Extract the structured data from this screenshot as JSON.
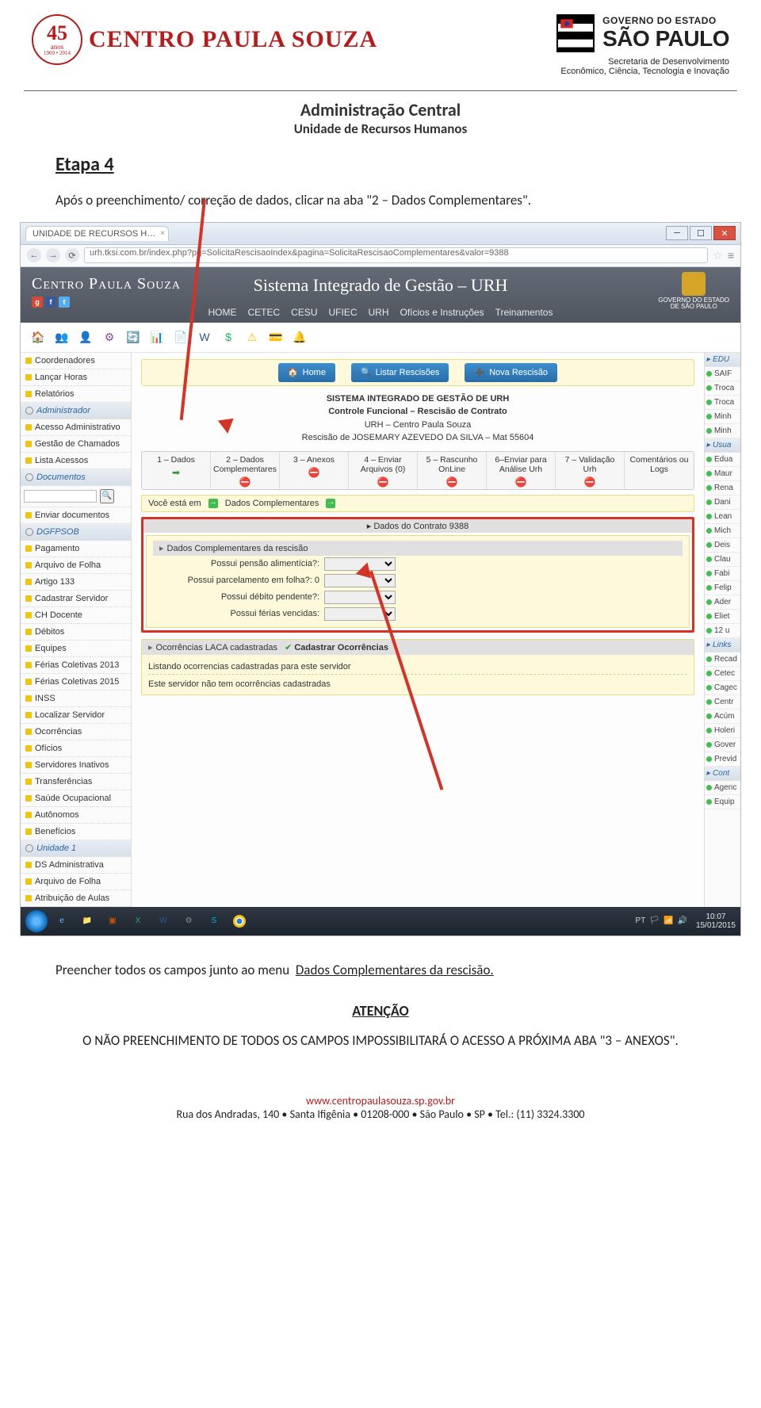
{
  "header": {
    "badge": {
      "years": "45",
      "sub_top": "anos",
      "sub_bottom": "1969 • 2014"
    },
    "cps": "CENTRO PAULA SOUZA",
    "sp": {
      "gov": "GOVERNO DO ESTADO",
      "state": "SÃO PAULO",
      "secretaria": "Secretaria de Desenvolvimento\nEconômico, Ciência, Tecnologia e Inovação"
    }
  },
  "titles": {
    "t1": "Administração Central",
    "t2": "Unidade de Recursos Humanos"
  },
  "etapa": "Etapa 4",
  "para_top": "Após o preenchimento/ correção de dados, clicar na aba \"2 – Dados Complementares\".",
  "para_below_shot": "Preencher todos os campos junto ao menu  Dados Complementares da rescisão.",
  "atencao": "ATENÇÃO",
  "para_warn": "O NÃO PREENCHIMENTO DE TODOS OS CAMPOS IMPOSSIBILITARÁ O ACESSO A PRÓXIMA ABA \"3 – ANEXOS\".",
  "footer": {
    "url": "www.centropaulasouza.sp.gov.br",
    "addr": "Rua dos Andradas, 140 • Santa Ifigênia • 01208-000 • São Paulo • SP • Tel.: (11) 3324.3300"
  },
  "shot": {
    "tab": "UNIDADE DE RECURSOS H…",
    "url": "urh.tksi.com.br/index.php?pg=SolicitaRescisaoIndex&pagina=SolicitaRescisaoComplementares&valor=9388",
    "app": {
      "logo": "Centro Paula Souza",
      "title": "Sistema Integrado de Gestão – URH",
      "menu": [
        "HOME",
        "CETEC",
        "CESU",
        "UFIEC",
        "URH",
        "Ofícios e Instruções",
        "Treinamentos"
      ],
      "crest": "GOVERNO DO ESTADO\nDE SÃO PAULO"
    },
    "left": [
      {
        "t": "Coordenadores"
      },
      {
        "t": "Lançar Horas"
      },
      {
        "t": "Relatórios"
      },
      {
        "t": "Administrador",
        "head": true
      },
      {
        "t": "Acesso Administrativo"
      },
      {
        "t": "Gestão de Chamados"
      },
      {
        "t": "Lista Acessos"
      },
      {
        "t": "Documentos",
        "head": true
      },
      {
        "t": "Busca Rápida",
        "search": true
      },
      {
        "t": "Enviar documentos"
      },
      {
        "t": "DGFPSOB",
        "head": true
      },
      {
        "t": "Pagamento"
      },
      {
        "t": "Arquivo de Folha"
      },
      {
        "t": "Artigo 133"
      },
      {
        "t": "Cadastrar Servidor"
      },
      {
        "t": "CH Docente"
      },
      {
        "t": "Débitos"
      },
      {
        "t": "Equipes"
      },
      {
        "t": "Férias Coletivas 2013"
      },
      {
        "t": "Férias Coletivas 2015"
      },
      {
        "t": "INSS"
      },
      {
        "t": "Localizar Servidor"
      },
      {
        "t": "Ocorrências"
      },
      {
        "t": "Ofícios"
      },
      {
        "t": "Servidores Inativos"
      },
      {
        "t": "Transferências"
      },
      {
        "t": "Saúde Ocupacional"
      },
      {
        "t": "Autônomos"
      },
      {
        "t": "Benefícios"
      },
      {
        "t": "Unidade 1",
        "head": true
      },
      {
        "t": "DS Administrativa"
      },
      {
        "t": "Arquivo de Folha"
      },
      {
        "t": "Atribuição de Aulas"
      }
    ],
    "right": [
      {
        "t": "EDU",
        "head": true
      },
      {
        "t": "SAIF"
      },
      {
        "t": "Troca"
      },
      {
        "t": "Troca"
      },
      {
        "t": "Minh"
      },
      {
        "t": "Minh"
      },
      {
        "t": "Usua",
        "head": true
      },
      {
        "t": "Edua"
      },
      {
        "t": "Maur"
      },
      {
        "t": "Rena"
      },
      {
        "t": "Dani"
      },
      {
        "t": "Lean"
      },
      {
        "t": "Mich"
      },
      {
        "t": "Deis"
      },
      {
        "t": "Clau"
      },
      {
        "t": "Fabi"
      },
      {
        "t": "Felip"
      },
      {
        "t": "Ader"
      },
      {
        "t": "Eliet"
      },
      {
        "t": "12 u"
      },
      {
        "t": "Links",
        "head": true
      },
      {
        "t": "Recad"
      },
      {
        "t": "Cetec"
      },
      {
        "t": "Cagec"
      },
      {
        "t": "Centr"
      },
      {
        "t": "Acúm"
      },
      {
        "t": "Holeri"
      },
      {
        "t": "Gover"
      },
      {
        "t": "Previd"
      },
      {
        "t": "Cont",
        "head": true
      },
      {
        "t": "Agenc"
      },
      {
        "t": "Equip"
      }
    ],
    "actions": {
      "home": "Home",
      "listar": "Listar Rescisões",
      "nova": "Nova Rescisão"
    },
    "sys": {
      "s1": "SISTEMA INTEGRADO DE GESTÃO DE URH",
      "s2": "Controle Funcional – Rescisão de Contrato",
      "s3": "URH – Centro Paula Souza",
      "s4": "Rescisão de JOSEMARY AZEVEDO DA SILVA – Mat 55604"
    },
    "tabs": [
      {
        "l": "1 – Dados",
        "m": "ok"
      },
      {
        "l": "2 – Dados Complementares",
        "m": "no"
      },
      {
        "l": "3 – Anexos",
        "m": "no"
      },
      {
        "l": "4 – Enviar Arquivos (0)",
        "m": "no"
      },
      {
        "l": "5 – Rascunho OnLine",
        "m": "no"
      },
      {
        "l": "6–Enviar para Análise Urh",
        "m": "no"
      },
      {
        "l": "7 – Validação Urh",
        "m": "no"
      },
      {
        "l": "Comentários ou Logs",
        "m": ""
      }
    ],
    "bc": {
      "pre": "Você está em",
      "cur": "Dados Complementares"
    },
    "contrato_hdr": "Dados do Contrato 9388",
    "red_panel": {
      "caption": "Dados Complementares da rescisão",
      "fields": [
        "Possui pensão alimentícia?:",
        "Possui parcelamento em folha?: 0",
        "Possui débito pendente?:",
        "Possui férias vencidas:"
      ]
    },
    "ocor": {
      "caption": "Ocorrências LACA cadastradas",
      "link": "Cadastrar Ocorrências",
      "line1": "Listando ocorrencias cadastradas para este servidor",
      "line2": "Este servidor não tem ocorrências cadastradas"
    },
    "clock": {
      "time": "10:07",
      "date": "15/01/2015"
    },
    "lang": "PT"
  }
}
